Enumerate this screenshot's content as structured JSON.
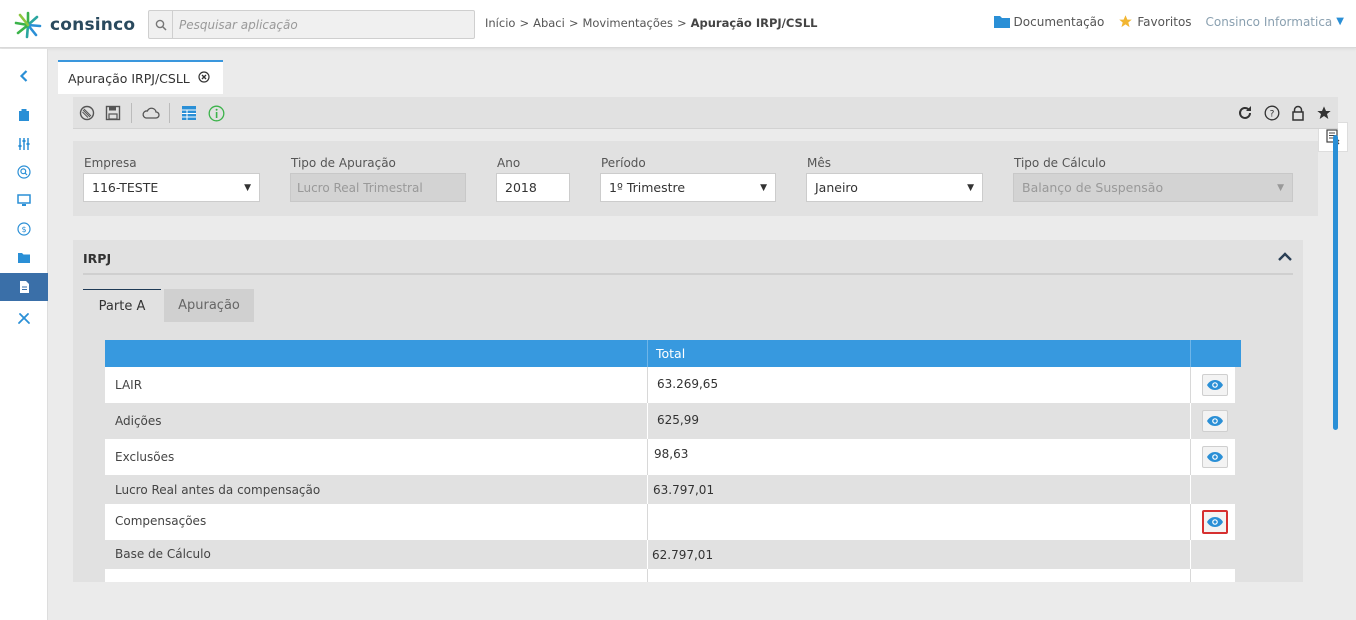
{
  "app": {
    "logo_text": "consinco",
    "search_placeholder": "Pesquisar aplicação"
  },
  "breadcrumb": [
    "Início",
    ">",
    "Abaci",
    ">",
    "Movimentações",
    ">",
    "Apuração IRPJ/CSLL"
  ],
  "header_right": {
    "documentation": "Documentação",
    "favorites": "Favoritos",
    "company": "Consinco Informatica"
  },
  "tab": {
    "label": "Apuração IRPJ/CSLL"
  },
  "filters": {
    "empresa": {
      "label": "Empresa",
      "value": "116-TESTE"
    },
    "tipo_apuracao": {
      "label": "Tipo de Apuração",
      "value": "Lucro Real Trimestral"
    },
    "ano": {
      "label": "Ano",
      "value": "2018"
    },
    "periodo": {
      "label": "Período",
      "value": "1º Trimestre"
    },
    "mes": {
      "label": "Mês",
      "value": "Janeiro"
    },
    "tipo_calculo": {
      "label": "Tipo de Cálculo",
      "value": "Balanço de Suspensão"
    }
  },
  "panel": {
    "title": "IRPJ",
    "subtabs": [
      "Parte A",
      "Apuração"
    ]
  },
  "table": {
    "header_total": "Total",
    "rows": [
      {
        "label": "LAIR",
        "total": "63.269,65",
        "has_view": true
      },
      {
        "label": "Adições",
        "total": "625,99",
        "has_view": true
      },
      {
        "label": "Exclusões",
        "total": "98,63",
        "has_view": true
      },
      {
        "label": "Lucro Real antes da compensação",
        "total": "63.797,01",
        "has_view": false
      },
      {
        "label": "Compensações",
        "total": "",
        "has_view": true,
        "highlighted": true
      },
      {
        "label": "Base de Cálculo",
        "total": "62.797,01",
        "has_view": false
      }
    ]
  },
  "colors": {
    "accent": "#2a8fd6",
    "table_header": "#3799df",
    "highlight_border": "#d63030"
  }
}
